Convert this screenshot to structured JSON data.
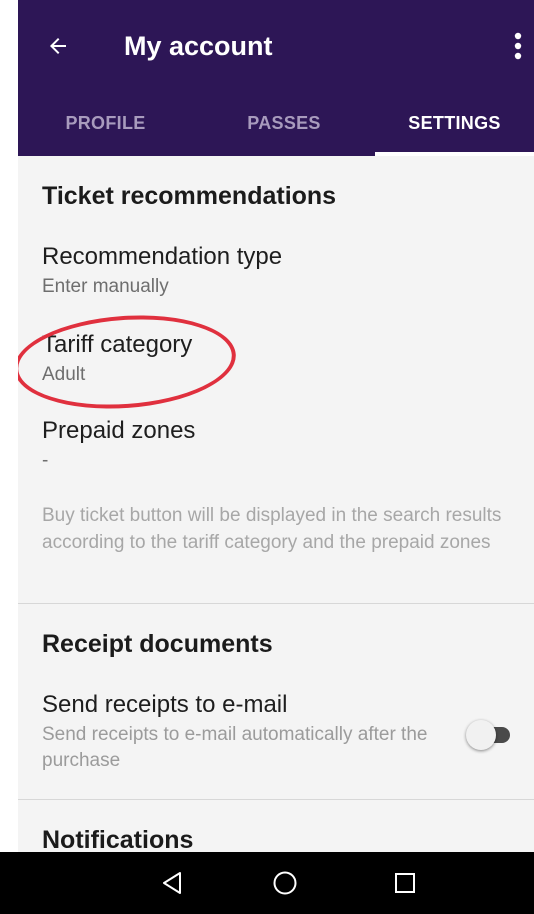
{
  "colors": {
    "appbar": "#2d1656",
    "accent_ring": "#e0303e",
    "background": "#f4f4f4"
  },
  "header": {
    "title": "My account",
    "back_icon": "arrow-left-icon",
    "menu_icon": "more-vertical-icon"
  },
  "tabs": [
    {
      "label": "PROFILE",
      "active": false
    },
    {
      "label": "PASSES",
      "active": false
    },
    {
      "label": "SETTINGS",
      "active": true
    }
  ],
  "ticket_recommendations": {
    "title": "Ticket recommendations",
    "recommendation_type": {
      "label": "Recommendation type",
      "value": "Enter manually"
    },
    "tariff_category": {
      "label": "Tariff category",
      "value": "Adult"
    },
    "prepaid_zones": {
      "label": "Prepaid zones",
      "value": "-"
    },
    "hint": "Buy ticket button will be displayed in the search results according to the tariff category and the prepaid zones"
  },
  "receipt_documents": {
    "title": "Receipt documents",
    "send_receipts": {
      "label": "Send receipts to e-mail",
      "description": "Send receipts to e-mail automatically after the purchase",
      "enabled": false
    }
  },
  "notifications": {
    "title": "Notifications"
  },
  "navbar": {
    "back_icon": "triangle-back-icon",
    "home_icon": "circle-home-icon",
    "recents_icon": "square-recents-icon"
  }
}
